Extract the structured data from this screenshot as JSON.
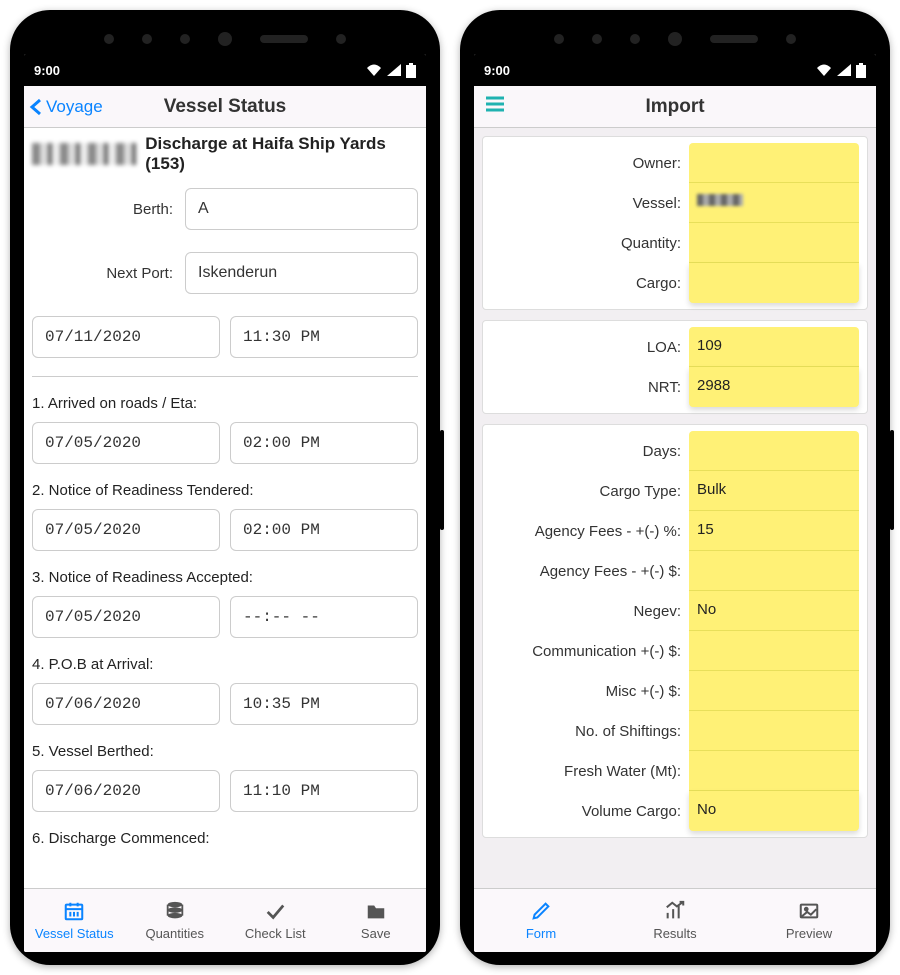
{
  "status": {
    "time": "9:00"
  },
  "left": {
    "back_label": "Voyage",
    "title": "Vessel Status",
    "heading": "Discharge at Haifa Ship Yards (153)",
    "berth": {
      "label": "Berth:",
      "value": "A"
    },
    "next_port": {
      "label": "Next Port:",
      "value": "Iskenderun"
    },
    "top_date": "07/11/2020",
    "top_time": "11:30 PM",
    "events": [
      {
        "label": "1. Arrived on roads / Eta:",
        "date": "07/05/2020",
        "time": "02:00 PM"
      },
      {
        "label": "2. Notice of Readiness Tendered:",
        "date": "07/05/2020",
        "time": "02:00 PM"
      },
      {
        "label": "3. Notice of Readiness Accepted:",
        "date": "07/05/2020",
        "time": "--:-- --"
      },
      {
        "label": "4. P.O.B at Arrival:",
        "date": "07/06/2020",
        "time": "10:35 PM"
      },
      {
        "label": "5. Vessel Berthed:",
        "date": "07/06/2020",
        "time": "11:10 PM"
      },
      {
        "label": "6. Discharge Commenced:",
        "date": "",
        "time": ""
      }
    ],
    "tabs": [
      {
        "label": "Vessel Status"
      },
      {
        "label": "Quantities"
      },
      {
        "label": "Check List"
      },
      {
        "label": "Save"
      }
    ]
  },
  "right": {
    "title": "Import",
    "cards": [
      [
        {
          "label": "Owner:",
          "value": ""
        },
        {
          "label": "Vessel:",
          "value": "",
          "blurred": true
        },
        {
          "label": "Quantity:",
          "value": ""
        },
        {
          "label": "Cargo:",
          "value": ""
        }
      ],
      [
        {
          "label": "LOA:",
          "value": "109"
        },
        {
          "label": "NRT:",
          "value": "2988"
        }
      ],
      [
        {
          "label": "Days:",
          "value": ""
        },
        {
          "label": "Cargo Type:",
          "value": "Bulk"
        },
        {
          "label": "Agency Fees - +(-) %:",
          "value": "15"
        },
        {
          "label": "Agency Fees - +(-) $:",
          "value": ""
        },
        {
          "label": "Negev:",
          "value": "No"
        },
        {
          "label": "Communication +(-) $:",
          "value": ""
        },
        {
          "label": "Misc +(-) $:",
          "value": ""
        },
        {
          "label": "No. of Shiftings:",
          "value": ""
        },
        {
          "label": "Fresh Water (Mt):",
          "value": ""
        },
        {
          "label": "Volume Cargo:",
          "value": "No"
        }
      ]
    ],
    "tabs": [
      {
        "label": "Form"
      },
      {
        "label": "Results"
      },
      {
        "label": "Preview"
      }
    ]
  }
}
